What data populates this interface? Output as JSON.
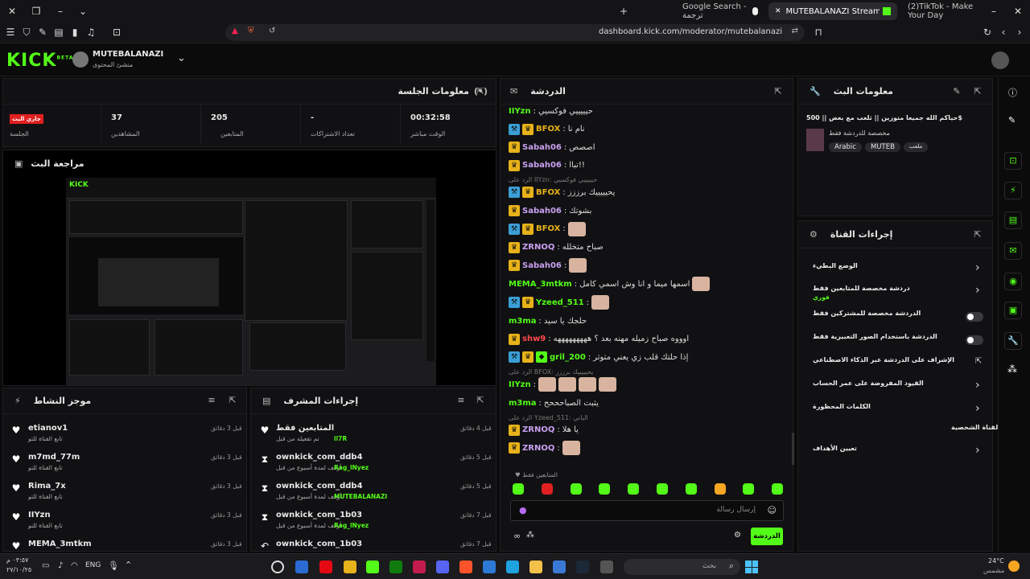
{
  "browser": {
    "tabs": [
      {
        "label": "Google Search - ترجمة"
      },
      {
        "label": "MUTEBALANAZI Stream - Kick D"
      },
      {
        "label": "(2)TikTok - Make Your Day"
      }
    ],
    "url": "dashboard.kick.com/moderator/mutebalanazi"
  },
  "header": {
    "logo": "KICK",
    "logo_sup": "BETA",
    "channel_name": "MUTEBALANAZI",
    "channel_role": "منشئ المحتوى"
  },
  "session": {
    "title": "معلومات الجلسة",
    "live_badge": "جاري البث",
    "live_label": "الجلسة",
    "viewers_value": "37",
    "viewers_label": "المشاهدين",
    "followers_value": "205",
    "followers_label": "المتابعين",
    "subs_value": "-",
    "subs_label": "تعداد الاشتراكات",
    "uptime_value": "00:32:58",
    "uptime_label": "الوقت مباشر"
  },
  "preview": {
    "title": "مراجعة البث"
  },
  "activity": {
    "title": "موجز النشاط",
    "items": [
      {
        "name": "etianov1",
        "sub": "تابع القناة للتو",
        "time": "قبل 3 دقائق"
      },
      {
        "name": "m7md_77m",
        "sub": "تابع القناة للتو",
        "time": "قبل 3 دقائق"
      },
      {
        "name": "Rima_7x",
        "sub": "تابع القناة للتو",
        "time": "قبل 3 دقائق"
      },
      {
        "name": "IIYzn",
        "sub": "تابع القناة للتو",
        "time": "قبل 3 دقائق"
      },
      {
        "name": "MEMA_3mtkm",
        "sub": "",
        "time": "قبل 3 دقائق"
      }
    ]
  },
  "modactions": {
    "title": "إجراءات المشرف",
    "items": [
      {
        "name": "المتابعين فقط",
        "sub": "تم تفعيله من قبل",
        "by": "ll7R",
        "time": "قبل 4 دقائق"
      },
      {
        "name": "ownkick_com_ddb4",
        "sub": "أوقف لمدة أسبوع من قبل",
        "by": "Rag_lNyez",
        "time": "قبل 5 دقائق"
      },
      {
        "name": "ownkick_com_ddb4",
        "sub": "أوقف لمدة أسبوع من قبل",
        "by": "MUTEBALANAZI",
        "time": "قبل 5 دقائق"
      },
      {
        "name": "ownkick_com_1b03",
        "sub": "أوقف لمدة أسبوع من قبل",
        "by": "Rag_lNyez",
        "time": "قبل 7 دقائق"
      },
      {
        "name": "ownkick_com_1b03",
        "sub": "",
        "by": "",
        "time": "قبل 7 دقائق"
      }
    ]
  },
  "chat": {
    "title": "الدردشة",
    "messages": [
      {
        "user": "IIYzn",
        "text": "حيييييي فوكسيي",
        "color": "#53fc18",
        "badges": []
      },
      {
        "user": "BFOX",
        "text": "نام نا",
        "color": "#e7b21a",
        "badges": [
          "blue",
          "gold"
        ]
      },
      {
        "user": "Sabah06",
        "text": "اصصص",
        "color": "#c9a0f0",
        "badges": [
          "gold"
        ]
      },
      {
        "user": "Sabah06",
        "text": "تباا!!",
        "color": "#c9a0f0",
        "badges": [
          "gold"
        ]
      },
      {
        "user": "BFOX",
        "text": "يحيييييك برززز",
        "color": "#e7b21a",
        "badges": [
          "blue",
          "gold"
        ],
        "reply": "الرد على IIYzn: حيييييي فوكسيي"
      },
      {
        "user": "Sabah06",
        "text": "بشوتك",
        "color": "#c9a0f0",
        "badges": [
          "gold"
        ]
      },
      {
        "user": "BFOX",
        "text": "",
        "color": "#e7b21a",
        "badges": [
          "blue",
          "gold"
        ],
        "emote": true
      },
      {
        "user": "ZRNOQ",
        "text": "صباح متخلله",
        "color": "#c9a0f0",
        "badges": [
          "gold"
        ]
      },
      {
        "user": "Sabah06",
        "text": "",
        "color": "#c9a0f0",
        "badges": [
          "gold"
        ],
        "emote": true
      },
      {
        "user": "MEMA_3mtkm",
        "text": "اسمها ميما و انا وش اسمي كامل",
        "color": "#53fc18",
        "badges": [],
        "emote": true
      },
      {
        "user": "Yzeed_511",
        "text": "",
        "color": "#53fc18",
        "badges": [
          "blue",
          "gold"
        ],
        "emote": true
      },
      {
        "user": "m3ma",
        "text": "حلجك يا سيد",
        "color": "#53fc18",
        "badges": []
      },
      {
        "user": "shw9",
        "text": "اوووه صباح زميله مهنه بعد ؟ هههههههههه",
        "color": "#ff4b4b",
        "badges": [
          "gold"
        ]
      },
      {
        "user": "gril_200",
        "text": "إذا حلتك قلب زي يعني متوثر",
        "color": "#53fc18",
        "badges": [
          "blue",
          "gold",
          "green"
        ]
      },
      {
        "user": "IIYzn",
        "text": "",
        "color": "#53fc18",
        "badges": [],
        "emote": true,
        "reply": "الرد على BFOX: يحيييييك برززز"
      },
      {
        "user": "m3ma",
        "text": "يثبت الصباحححح",
        "color": "#53fc18",
        "badges": []
      },
      {
        "user": "ZRNOQ",
        "text": "يا هلا",
        "color": "#c9a0f0",
        "badges": [
          "gold"
        ],
        "reply": "الرد على Yzeed_511: الباني"
      },
      {
        "user": "ZRNOQ",
        "text": "",
        "color": "#c9a0f0",
        "badges": [
          "gold"
        ],
        "emote": true
      }
    ],
    "followers_only_note": "المتابعين فقط",
    "input_placeholder": "إرسال رسالة",
    "send_label": "الدردشة"
  },
  "streaminfo": {
    "title": "معلومات البث",
    "stream_title": "حياكم الله جميعا متوزين || ثلعب مع بعض || 500$",
    "category": "مخصصة للدردشة فقط",
    "tags": [
      "Arabic",
      "MUTEB",
      "ملعب"
    ]
  },
  "channelactions": {
    "title": "إجراءات القناة",
    "rows": [
      {
        "label": "الوضع البطيء",
        "control": "chevron"
      },
      {
        "label": "دردشة مخصصة للمتابعين فقط",
        "sub": "فوري",
        "control": "chevron"
      },
      {
        "label": "الدردشة مخصصة للمشتركين فقط",
        "control": "toggle"
      },
      {
        "label": "الدردشة باستخدام الصور التعبيرية فقط",
        "control": "toggle"
      },
      {
        "label": "الإشراف على الدردشة عبر الذكاء الاصطناعي",
        "control": "external"
      },
      {
        "label": "القيود المفروضة على عمر الحساب",
        "control": "chevron"
      },
      {
        "label": "الكلمات المحظورة",
        "control": "chevron"
      },
      {
        "label": "القناة الشخصية",
        "control": "none"
      },
      {
        "label": "تعيين الأهداف",
        "control": "chevron"
      }
    ]
  },
  "taskbar": {
    "lang": "ENG",
    "clock": "٠٣:٥٧ م",
    "date": "٢٧/١٠/٢٥",
    "search_placeholder": "بحث",
    "weather_temp": "24°C",
    "weather_desc": "مشمس"
  },
  "colors": {
    "kick_green": "#53fc18",
    "bg": "#0b0b0c",
    "panel": "#111113"
  }
}
